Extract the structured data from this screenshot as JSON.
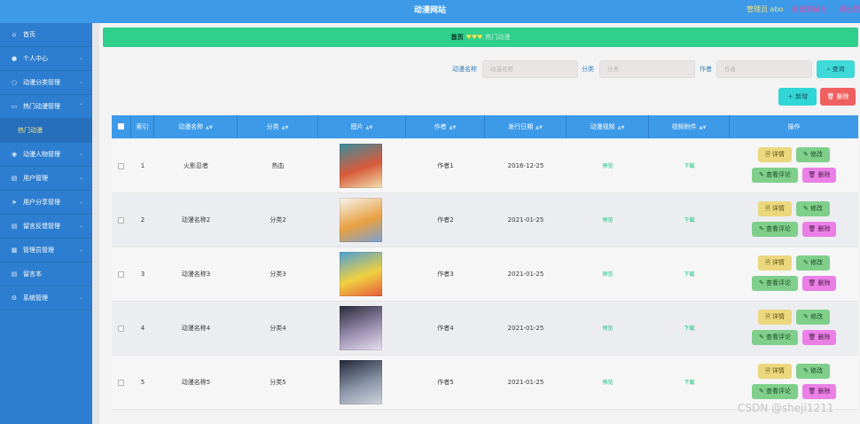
{
  "header": {
    "title": "动漫网站",
    "admin_label": "管理员 abo",
    "exit_label": "退出到前台",
    "logout_label": "退出登录"
  },
  "sidebar": {
    "items": [
      {
        "label": "首页",
        "icon": "home-icon"
      },
      {
        "label": "个人中心",
        "icon": "user-icon"
      },
      {
        "label": "动漫分类管理",
        "icon": "circle-icon"
      },
      {
        "label": "热门动漫管理",
        "icon": "book-icon"
      },
      {
        "label": "热门动漫",
        "icon": "none",
        "sub": true
      },
      {
        "label": "动漫人物管理",
        "icon": "pin-icon"
      },
      {
        "label": "用户管理",
        "icon": "doc-icon"
      },
      {
        "label": "用户分享管理",
        "icon": "send-icon"
      },
      {
        "label": "留言反馈管理",
        "icon": "doc-icon"
      },
      {
        "label": "管理员管理",
        "icon": "grid-icon"
      },
      {
        "label": "留言本",
        "icon": "doc-icon"
      },
      {
        "label": "系统管理",
        "icon": "gear-icon"
      }
    ]
  },
  "breadcrumb": {
    "home": "首页",
    "hearts": "♥♥♥",
    "current": "热门动漫"
  },
  "filters": {
    "name_label": "动漫名称",
    "name_placeholder": "动漫名称",
    "category_label": "分类",
    "category_placeholder": "分类",
    "author_label": "作者",
    "author_placeholder": "作者",
    "query_label": "⌕ 查询"
  },
  "actions": {
    "add_label": "＋ 新增",
    "delete_label": "🗑 删除"
  },
  "table": {
    "columns": [
      "索引",
      "动漫名称",
      "分类",
      "图片",
      "作者",
      "发行日期",
      "动漫视频",
      "视频附件",
      "操作"
    ],
    "rows": [
      {
        "index": "1",
        "name": "火影忍者",
        "category": "热血",
        "author": "作者1",
        "date": "2016-12-25",
        "video": "预览",
        "attachment": "下载",
        "thumb": [
          "#3a8fa0",
          "#d85a3a",
          "#f0e2b0"
        ]
      },
      {
        "index": "2",
        "name": "动漫名称2",
        "category": "分类2",
        "author": "作者2",
        "date": "2021-01-25",
        "video": "预览",
        "attachment": "下载",
        "thumb": [
          "#f5f5f0",
          "#e9a040",
          "#7aa0d8"
        ]
      },
      {
        "index": "3",
        "name": "动漫名称3",
        "category": "分类3",
        "author": "作者3",
        "date": "2021-01-25",
        "video": "预览",
        "attachment": "下载",
        "thumb": [
          "#4aa0d8",
          "#f0d040",
          "#e65a3a"
        ]
      },
      {
        "index": "4",
        "name": "动漫名称4",
        "category": "分类4",
        "author": "作者4",
        "date": "2021-01-25",
        "video": "预览",
        "attachment": "下载",
        "thumb": [
          "#2a2a3a",
          "#9a8fb0",
          "#e8e0ee"
        ]
      },
      {
        "index": "5",
        "name": "动漫名称5",
        "category": "分类5",
        "author": "作者5",
        "date": "2021-01-25",
        "video": "预览",
        "attachment": "下载",
        "thumb": [
          "#23283a",
          "#8a95a8",
          "#d0d4dc"
        ]
      }
    ],
    "row_actions": {
      "detail": "🗎 详情",
      "edit": "✎ 修改",
      "comment": "✎ 查看评论",
      "delete": "🗑 删除"
    }
  },
  "watermark": "CSDN @sheji1211"
}
